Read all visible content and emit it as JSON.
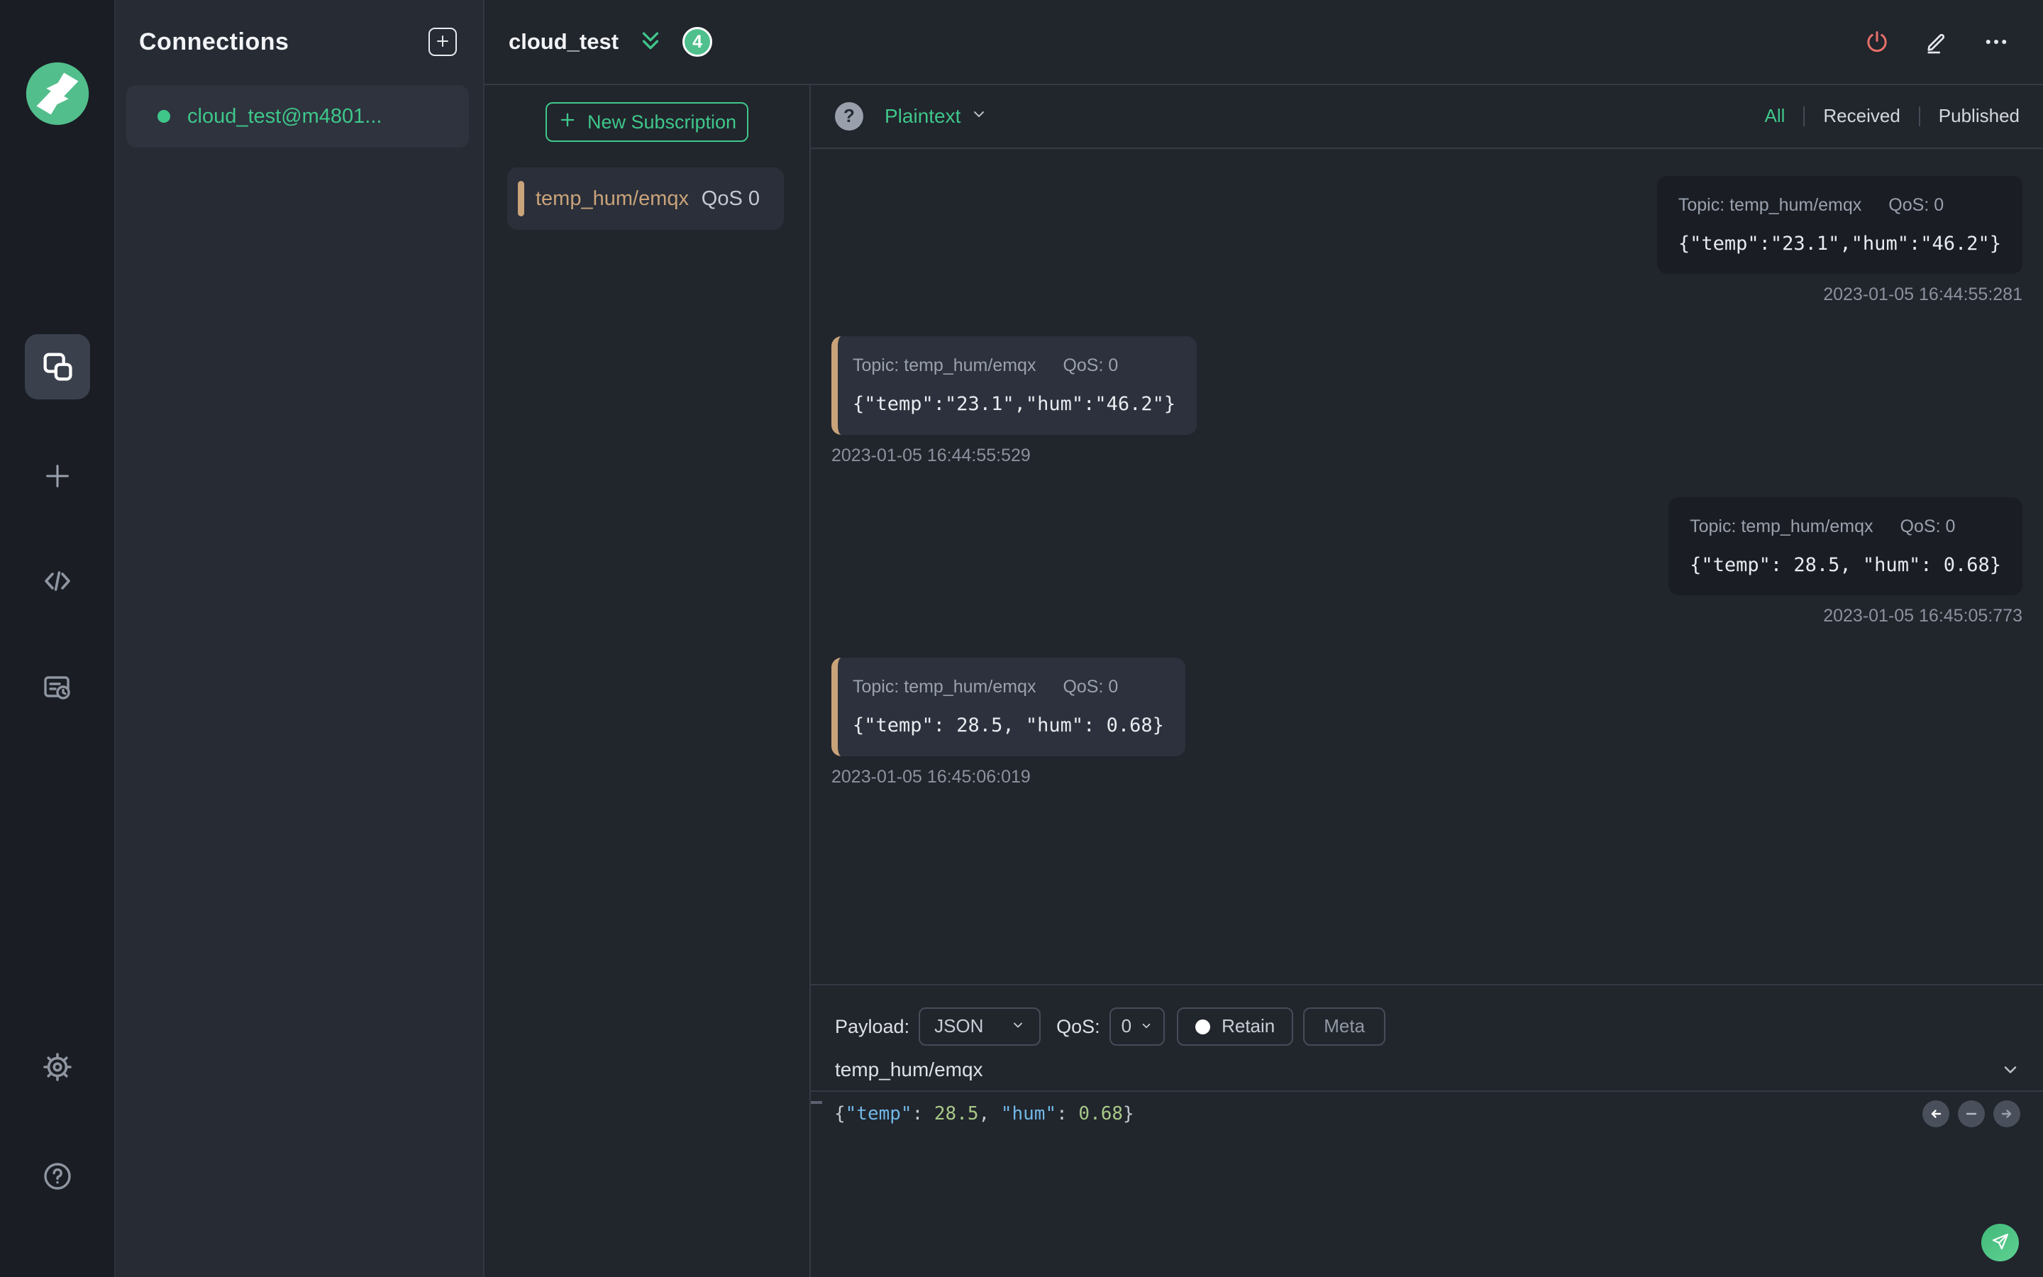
{
  "colors": {
    "accent_green": "#3fc78a",
    "badge_green": "#4fc08d",
    "topic_orange": "#c9a379",
    "danger_red": "#e8706a",
    "panel_dark": "#21252c",
    "received_bubble": "#2c313d",
    "published_bubble": "#1a1d24"
  },
  "sidebar": {
    "icons": [
      "mqttx-logo",
      "connections-icon",
      "new-connection-plus-icon",
      "script-code-icon",
      "log-icon",
      "settings-gear-icon",
      "help-icon"
    ]
  },
  "connections": {
    "title": "Connections",
    "items": [
      {
        "label": "cloud_test@m4801...",
        "status": "connected"
      }
    ]
  },
  "header": {
    "title": "cloud_test",
    "badge_count": "4",
    "actions": [
      "disconnect-power-icon",
      "edit-pencil-icon",
      "more-ellipsis-icon"
    ]
  },
  "subscriptions": {
    "new_button_label": "New Subscription",
    "items": [
      {
        "topic": "temp_hum/emqx",
        "qos": "QoS 0"
      }
    ]
  },
  "messages": {
    "format_label": "Plaintext",
    "filters": [
      {
        "label": "All",
        "active": true
      },
      {
        "label": "Received",
        "active": false
      },
      {
        "label": "Published",
        "active": false
      }
    ],
    "items": [
      {
        "direction": "published",
        "topic_label": "Topic: temp_hum/emqx",
        "qos_label": "QoS: 0",
        "payload": "{\"temp\":\"23.1\",\"hum\":\"46.2\"}",
        "timestamp": "2023-01-05 16:44:55:281"
      },
      {
        "direction": "received",
        "topic_label": "Topic: temp_hum/emqx",
        "qos_label": "QoS: 0",
        "payload": "{\"temp\":\"23.1\",\"hum\":\"46.2\"}",
        "timestamp": "2023-01-05 16:44:55:529"
      },
      {
        "direction": "published",
        "topic_label": "Topic: temp_hum/emqx",
        "qos_label": "QoS: 0",
        "payload": "{\"temp\": 28.5, \"hum\": 0.68}",
        "timestamp": "2023-01-05 16:45:05:773"
      },
      {
        "direction": "received",
        "topic_label": "Topic: temp_hum/emqx",
        "qos_label": "QoS: 0",
        "payload": "{\"temp\": 28.5, \"hum\": 0.68}",
        "timestamp": "2023-01-05 16:45:06:019"
      }
    ]
  },
  "publish": {
    "payload_label": "Payload:",
    "payload_format": "JSON",
    "qos_label": "QoS:",
    "qos_value": "0",
    "retain_label": "Retain",
    "meta_label": "Meta",
    "topic_value": "temp_hum/emqx",
    "payload_value": "{\"temp\": 28.5, \"hum\": 0.68}"
  }
}
